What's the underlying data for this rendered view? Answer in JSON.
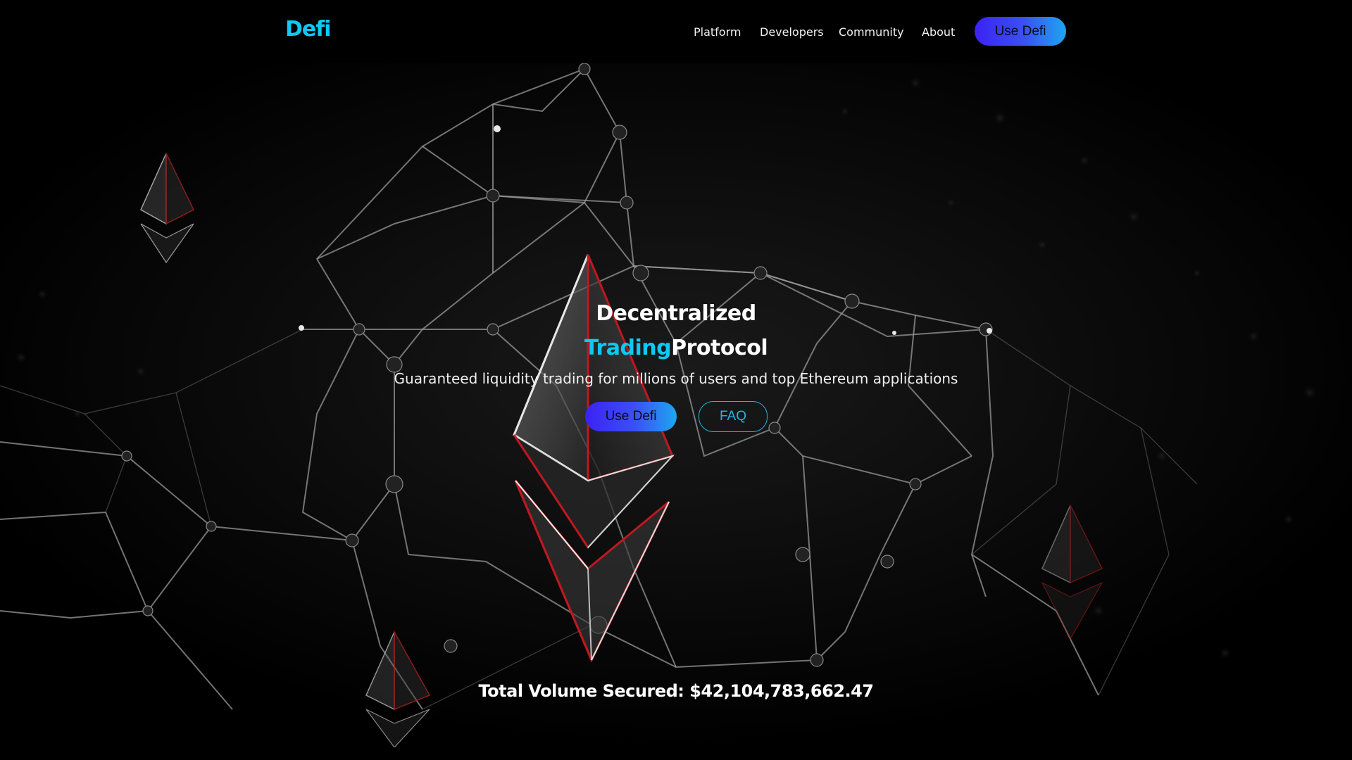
{
  "header": {
    "logo": "Defi",
    "nav": [
      "Platform",
      "Developers",
      "Community",
      "About"
    ],
    "cta_label": "Use Defi"
  },
  "hero": {
    "title_line1": "Decentralized",
    "title_accent": "Trading",
    "title_rest": "Protocol",
    "subtitle": "Guaranteed liquidity trading for millions of users and top Ethereum applications",
    "primary_button": "Use Defi",
    "secondary_button": "FAQ",
    "volume_text": "Total Volume Secured: $42,104,783,662.47"
  },
  "colors": {
    "accent": "#0ec9f2",
    "button_gradient_start": "#3b22f5",
    "button_gradient_end": "#1ea6f0",
    "background": "#000000",
    "highlight_red": "#d81b2a"
  },
  "icons": {
    "hero_graphic": "ethereum-crystal-network-graphic"
  }
}
